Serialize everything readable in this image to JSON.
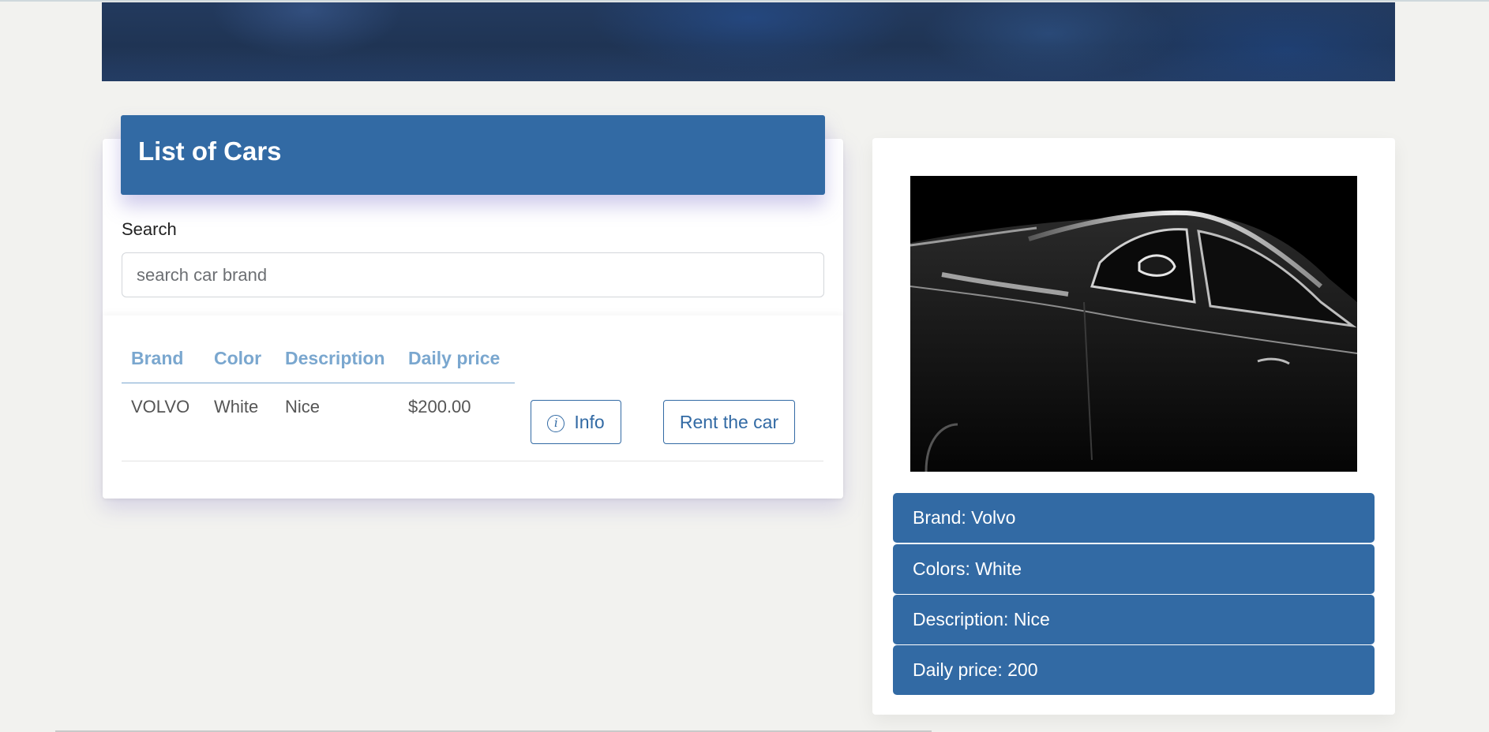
{
  "list": {
    "title": "List of Cars",
    "search_label": "Search",
    "search_placeholder": "search car brand",
    "search_value": "",
    "columns": [
      "Brand",
      "Color",
      "Description",
      "Daily price"
    ],
    "rows": [
      {
        "brand": "VOLVO",
        "color": "White",
        "description": "Nice",
        "daily_price": "$200.00",
        "info_label": "Info",
        "rent_label": "Rent the car"
      }
    ]
  },
  "detail": {
    "brand": "Brand: Volvo",
    "colors": "Colors: White",
    "description": "Description: Nice",
    "daily_price": "Daily price: 200"
  },
  "colors": {
    "primary": "#326aa4",
    "header_text": "#7aa7cf",
    "background": "#f2f2ef"
  },
  "icons": {
    "info": "info-circle-icon"
  }
}
